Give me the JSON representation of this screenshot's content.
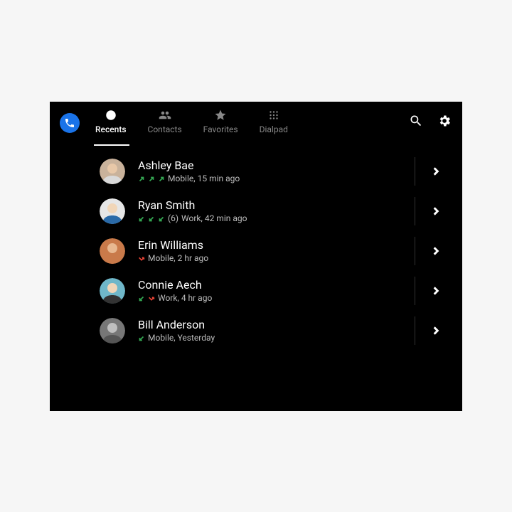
{
  "tabs": [
    {
      "label": "Recents",
      "active": true,
      "icon": "clock"
    },
    {
      "label": "Contacts",
      "active": false,
      "icon": "people"
    },
    {
      "label": "Favorites",
      "active": false,
      "icon": "star"
    },
    {
      "label": "Dialpad",
      "active": false,
      "icon": "dialpad"
    }
  ],
  "calls": [
    {
      "name": "Ashley Bae",
      "arrows": [
        "out",
        "out",
        "out"
      ],
      "count": null,
      "line": "Mobile",
      "time": "15 min ago",
      "avatar": {
        "bg": "#c9b29b",
        "shirt": "#d9d9d9",
        "head": "#e8c8a8"
      }
    },
    {
      "name": "Ryan Smith",
      "arrows": [
        "in",
        "in",
        "in"
      ],
      "count": "(6)",
      "line": "Work",
      "time": "42 min ago",
      "avatar": {
        "bg": "#e6e6e6",
        "shirt": "#2a6aa8",
        "head": "#f1d6b8"
      }
    },
    {
      "name": "Erin Williams",
      "arrows": [
        "missed"
      ],
      "count": null,
      "line": "Mobile",
      "time": "2 hr ago",
      "avatar": {
        "bg": "#c97a4a",
        "shirt": "#c97a4a",
        "head": "#e8b890"
      }
    },
    {
      "name": "Connie Aech",
      "arrows": [
        "in",
        "missed"
      ],
      "count": null,
      "line": "Work",
      "time": "4 hr ago",
      "avatar": {
        "bg": "#6fb7c9",
        "shirt": "#333333",
        "head": "#f1d6b8"
      }
    },
    {
      "name": "Bill Anderson",
      "arrows": [
        "in"
      ],
      "count": null,
      "line": "Mobile",
      "time": "Yesterday",
      "avatar": {
        "bg": "#777777",
        "shirt": "#555555",
        "head": "#bfbfbf"
      }
    }
  ]
}
